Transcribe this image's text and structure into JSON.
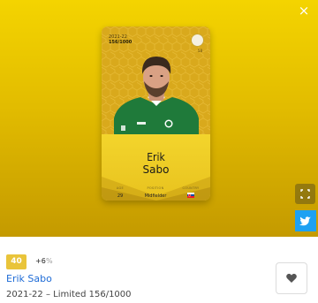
{
  "viewer": {
    "close_label": "×"
  },
  "card": {
    "season": "2021-22",
    "serial": "156/1000",
    "badge_number": "58",
    "first_name": "Erik",
    "last_name": "Sabo",
    "stats": [
      {
        "label": "AGE",
        "value": "29"
      },
      {
        "label": "POSITION",
        "value": "Midfielder"
      },
      {
        "label": "COUNTRY",
        "value": ""
      }
    ],
    "country_flag": "slovakia-flag",
    "colors": {
      "card_gold": "#e0b923",
      "jersey_green": "#1f7a3a"
    }
  },
  "info": {
    "level": "40",
    "bonus": "+6",
    "bonus_icon": "%",
    "player_name": "Erik Sabo",
    "description": "2021-22 – Limited 156/1000"
  },
  "icons": {
    "close": "close-icon",
    "expand": "expand-icon",
    "twitter": "twitter-icon",
    "heart": "heart-icon"
  },
  "colors": {
    "link_blue": "#1e6bd6",
    "twitter_blue": "#1da1f2",
    "level_gold": "#e9c43a"
  }
}
